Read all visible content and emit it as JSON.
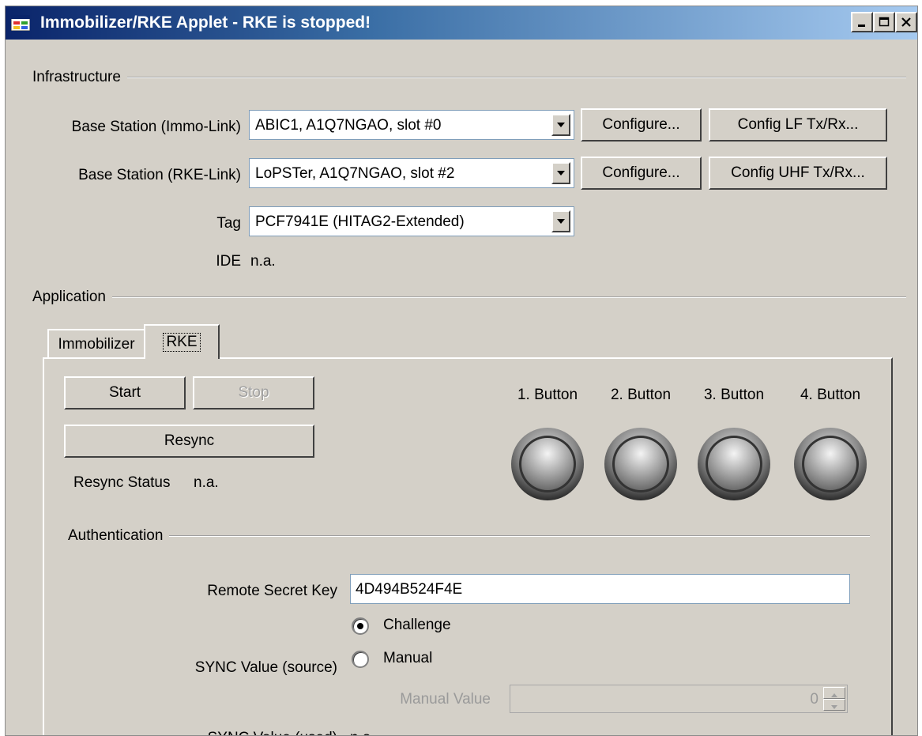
{
  "window": {
    "title": "Immobilizer/RKE Applet - RKE is stopped!",
    "controls": {
      "minimize": "_",
      "maximize": "□",
      "close": "✕"
    }
  },
  "infrastructure": {
    "group_label": "Infrastructure",
    "immo_link": {
      "label": "Base Station (Immo-Link)",
      "value": "ABIC1, A1Q7NGAO, slot #0",
      "configure": "Configure...",
      "config_tx": "Config LF Tx/Rx..."
    },
    "rke_link": {
      "label": "Base Station (RKE-Link)",
      "value": "LoPSTer, A1Q7NGAO, slot #2",
      "configure": "Configure...",
      "config_tx": "Config UHF Tx/Rx..."
    },
    "tag": {
      "label": "Tag",
      "value": "PCF7941E (HITAG2-Extended)"
    },
    "ide": {
      "label": "IDE",
      "value": "n.a."
    }
  },
  "application": {
    "group_label": "Application",
    "tabs": [
      {
        "label": "Immobilizer"
      },
      {
        "label": "RKE"
      }
    ],
    "start": "Start",
    "stop": "Stop",
    "resync": "Resync",
    "resync_status": {
      "label": "Resync Status",
      "value": "n.a."
    },
    "buttons": [
      {
        "label": "1. Button"
      },
      {
        "label": "2. Button"
      },
      {
        "label": "3. Button"
      },
      {
        "label": "4. Button"
      }
    ],
    "authentication": {
      "group_label": "Authentication",
      "remote_secret_key": {
        "label": "Remote Secret Key",
        "value": "4D494B524F4E"
      },
      "sync_source": {
        "label": "SYNC Value (source)",
        "options": [
          {
            "label": "Challenge",
            "selected": true
          },
          {
            "label": "Manual",
            "selected": false
          }
        ]
      },
      "manual_value": {
        "label": "Manual Value",
        "value": "0"
      },
      "sync_used": {
        "label": "SYNC Value (used)",
        "value": "n.a."
      }
    }
  },
  "colors": {
    "face": "#d4d0c8",
    "title_start": "#0a246a",
    "title_end": "#a6caf0"
  }
}
